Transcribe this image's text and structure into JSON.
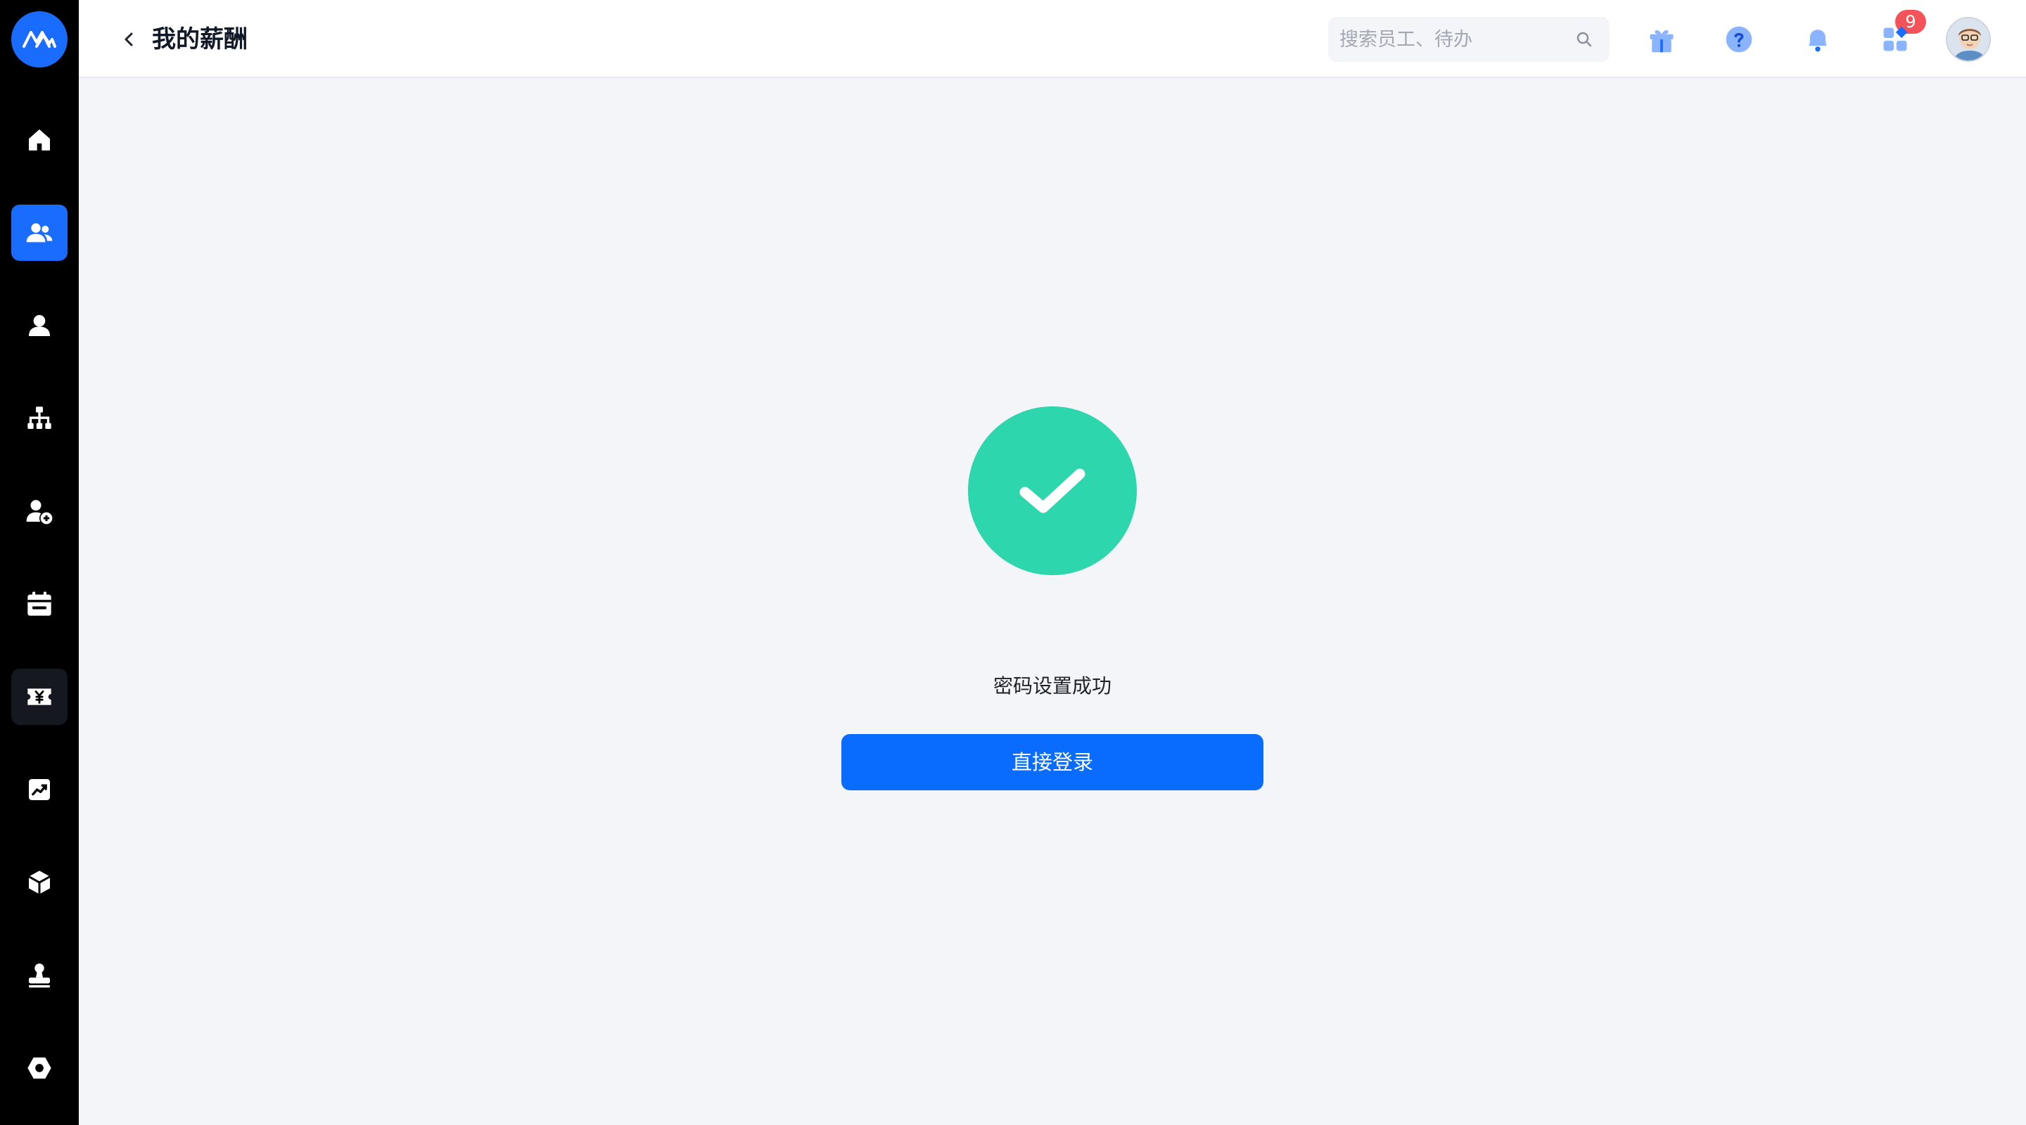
{
  "app": {
    "logo_icon": "brand-mountain-logo",
    "brand_color": "#1a6cff"
  },
  "sidebar": {
    "items": [
      {
        "icon": "home-icon",
        "active": false
      },
      {
        "icon": "people-icon",
        "active": true
      },
      {
        "icon": "person-icon",
        "active": false
      },
      {
        "icon": "org-chart-icon",
        "active": false
      },
      {
        "icon": "person-add-icon",
        "active": false
      },
      {
        "icon": "calendar-icon",
        "active": false
      },
      {
        "icon": "salary-yen-icon",
        "active": false,
        "hover": true
      },
      {
        "icon": "chart-trend-icon",
        "active": false
      },
      {
        "icon": "cube-icon",
        "active": false
      },
      {
        "icon": "stamp-icon",
        "active": false
      },
      {
        "icon": "settings-hex-icon",
        "active": false
      }
    ]
  },
  "header": {
    "back_icon": "chevron-left-icon",
    "title": "我的薪酬",
    "search": {
      "placeholder": "搜索员工、待办",
      "value": ""
    },
    "icons": [
      "gift-icon",
      "help-icon",
      "bell-icon",
      "apps-icon"
    ],
    "notification_count": "9",
    "badge_color": "#f4535a"
  },
  "main": {
    "status_icon": "check-circle-icon",
    "status_color": "#2dd6ac",
    "message": "密码设置成功",
    "button_label": "直接登录",
    "button_color": "#0a6cff"
  }
}
